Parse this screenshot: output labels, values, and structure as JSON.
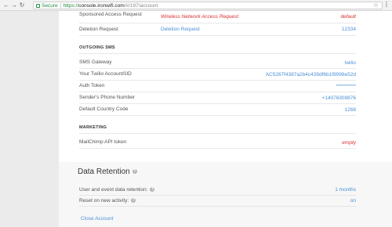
{
  "browser": {
    "secure_label": "Secure",
    "url_scheme": "https://",
    "url_host": "console.ironwifi.com",
    "url_path": "/#/197/account"
  },
  "account_rows": [
    {
      "label": "Sponsored Access Request",
      "mid": "Wireless Network Access Request",
      "value": "default"
    },
    {
      "label": "Deletion Request",
      "mid": "Deletion Request",
      "value": "12334"
    }
  ],
  "outgoing_sms": {
    "heading": "OUTGOING SMS",
    "rows": [
      {
        "label": "SMS Gateway",
        "value": "twilio"
      },
      {
        "label": "Your Twilio AccountSID",
        "value": "AC5267f4387a2b4c439df6b1f8998e52d"
      },
      {
        "label": "Auth Token",
        "value": "**********"
      },
      {
        "label": "Sender's Phone Number",
        "value": "+14076309876"
      },
      {
        "label": "Default Country Code",
        "value": "1268"
      }
    ]
  },
  "marketing": {
    "heading": "MARKETING",
    "rows": [
      {
        "label": "MailChimp API token",
        "value": "empty"
      }
    ]
  },
  "data_retention": {
    "title": "Data Retention",
    "rows": [
      {
        "label": "User and event data retention:",
        "value": "1 months"
      },
      {
        "label": "Reset on new activity:",
        "value": "on"
      }
    ],
    "close_account": "Close Account"
  },
  "colors": {
    "link": "#4a90d6",
    "empty_red": "#d9302c",
    "secure_green": "#1e8e3e"
  }
}
